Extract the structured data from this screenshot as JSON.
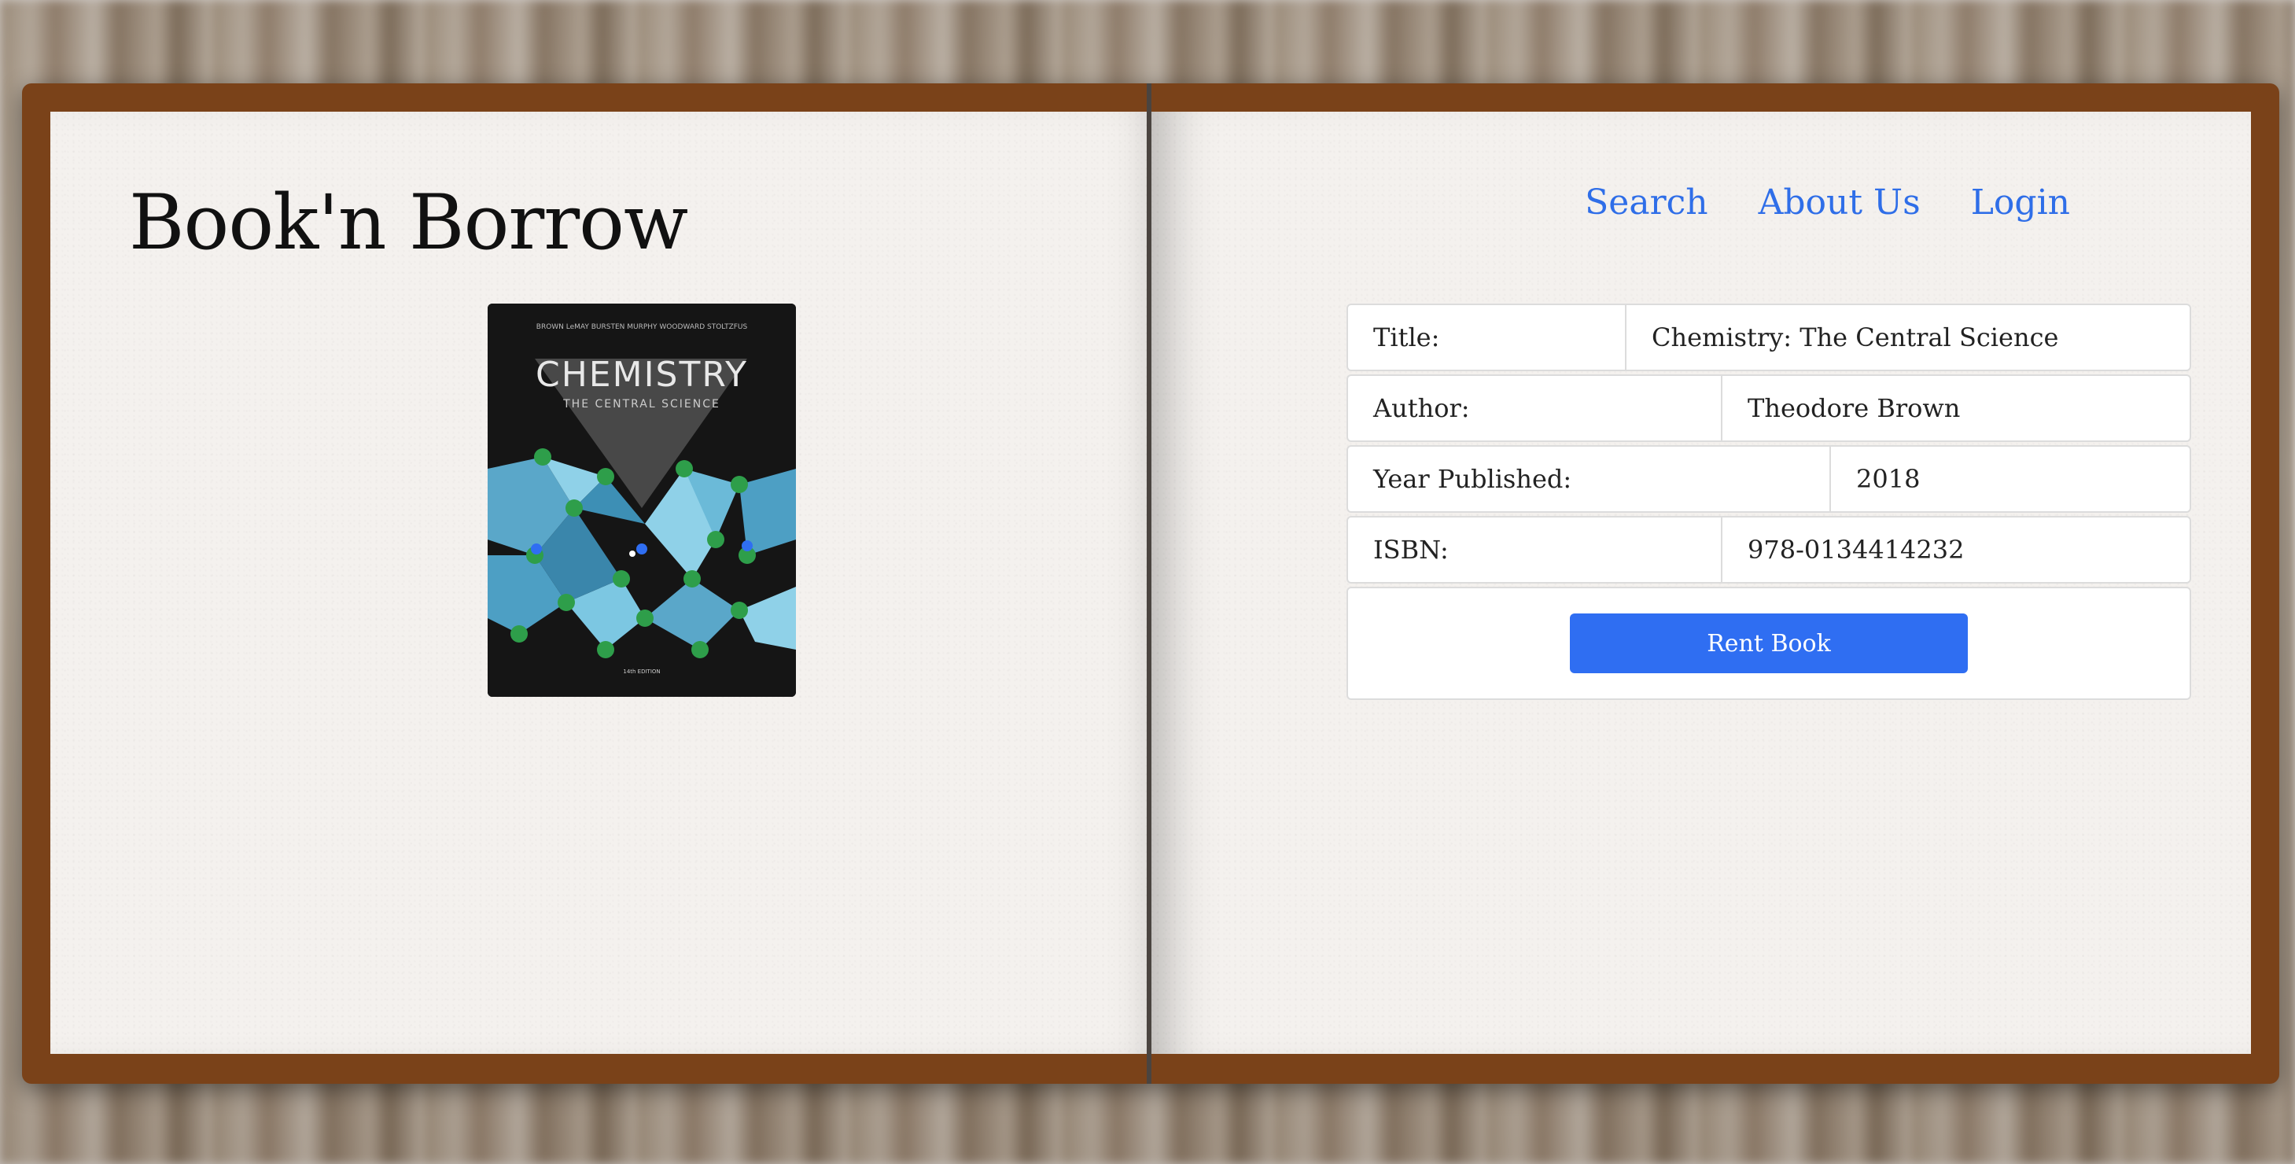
{
  "brand": {
    "name": "Book'n Borrow"
  },
  "nav": {
    "items": [
      {
        "label": "Search"
      },
      {
        "label": "About Us"
      },
      {
        "label": "Login"
      }
    ]
  },
  "cover": {
    "authors_line": "BROWN  LeMAY  BURSTEN  MURPHY  WOODWARD  STOLTZFUS",
    "title": "CHEMISTRY",
    "subtitle": "THE CENTRAL SCIENCE",
    "edition": "14th EDITION"
  },
  "details": {
    "title_label": "Title:",
    "title_value": "Chemistry: The Central Science",
    "author_label": "Author:",
    "author_value": "Theodore Brown",
    "year_label": "Year Published:",
    "year_value": "2018",
    "isbn_label": "ISBN:",
    "isbn_value": "978-0134414232"
  },
  "actions": {
    "rent_label": "Rent Book"
  },
  "colors": {
    "link": "#2f6ee8",
    "button": "#2f6ef2",
    "book_frame": "#7a4219",
    "page": "#f4f1ee"
  }
}
